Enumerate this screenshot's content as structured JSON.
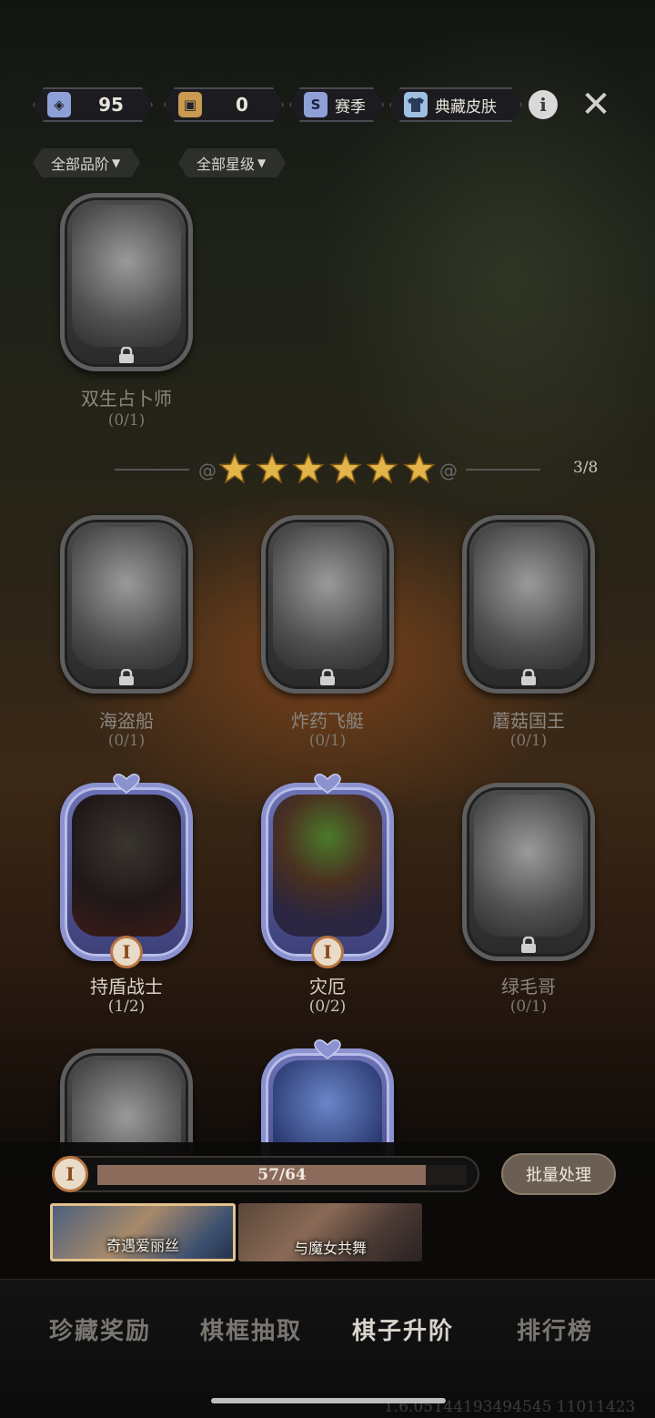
{
  "currencies": [
    {
      "name": "card-currency",
      "value": "95",
      "icon": "blue-card-icon",
      "color": "#8ea0d8"
    },
    {
      "name": "gold-currency",
      "value": "0",
      "icon": "gold-card-icon",
      "color": "#c99a50"
    }
  ],
  "tabs_top": [
    {
      "label": "赛季",
      "icon": "season-s-icon"
    },
    {
      "label": "典藏皮肤",
      "icon": "shirt-icon"
    }
  ],
  "filters": {
    "quality": "全部品阶",
    "stars": "全部星级"
  },
  "top_card": {
    "name": "双生占卜师",
    "count": "(0/1)"
  },
  "star_section": {
    "stars": 6,
    "progress": "3/8"
  },
  "cards": [
    {
      "name": "海盗船",
      "count": "(0/1)",
      "owned": false
    },
    {
      "name": "炸药飞艇",
      "count": "(0/1)",
      "owned": false
    },
    {
      "name": "蘑菇国王",
      "count": "(0/1)",
      "owned": false
    },
    {
      "name": "持盾战士",
      "count": "(1/2)",
      "owned": true,
      "tier": "I"
    },
    {
      "name": "灾厄",
      "count": "(0/2)",
      "owned": true,
      "tier": "I"
    },
    {
      "name": "绿毛哥",
      "count": "(0/1)",
      "owned": false
    }
  ],
  "progress": {
    "tier": "I",
    "text": "57/64",
    "fraction": 0.89
  },
  "batch_button": "批量处理",
  "banners": [
    {
      "label": "奇遇爱丽丝",
      "selected": true
    },
    {
      "label": "与魔女共舞",
      "selected": false
    }
  ],
  "nav": [
    {
      "label": "珍藏奖励",
      "active": false
    },
    {
      "label": "棋框抽取",
      "active": false
    },
    {
      "label": "棋子升阶",
      "active": true
    },
    {
      "label": "排行榜",
      "active": false
    }
  ],
  "version": "1.6.05T44193494545 11011423",
  "colors": {
    "accent_gold": "#e2b44a",
    "owned_frame": "#8b92cf",
    "tier_badge": "#b7743f"
  }
}
